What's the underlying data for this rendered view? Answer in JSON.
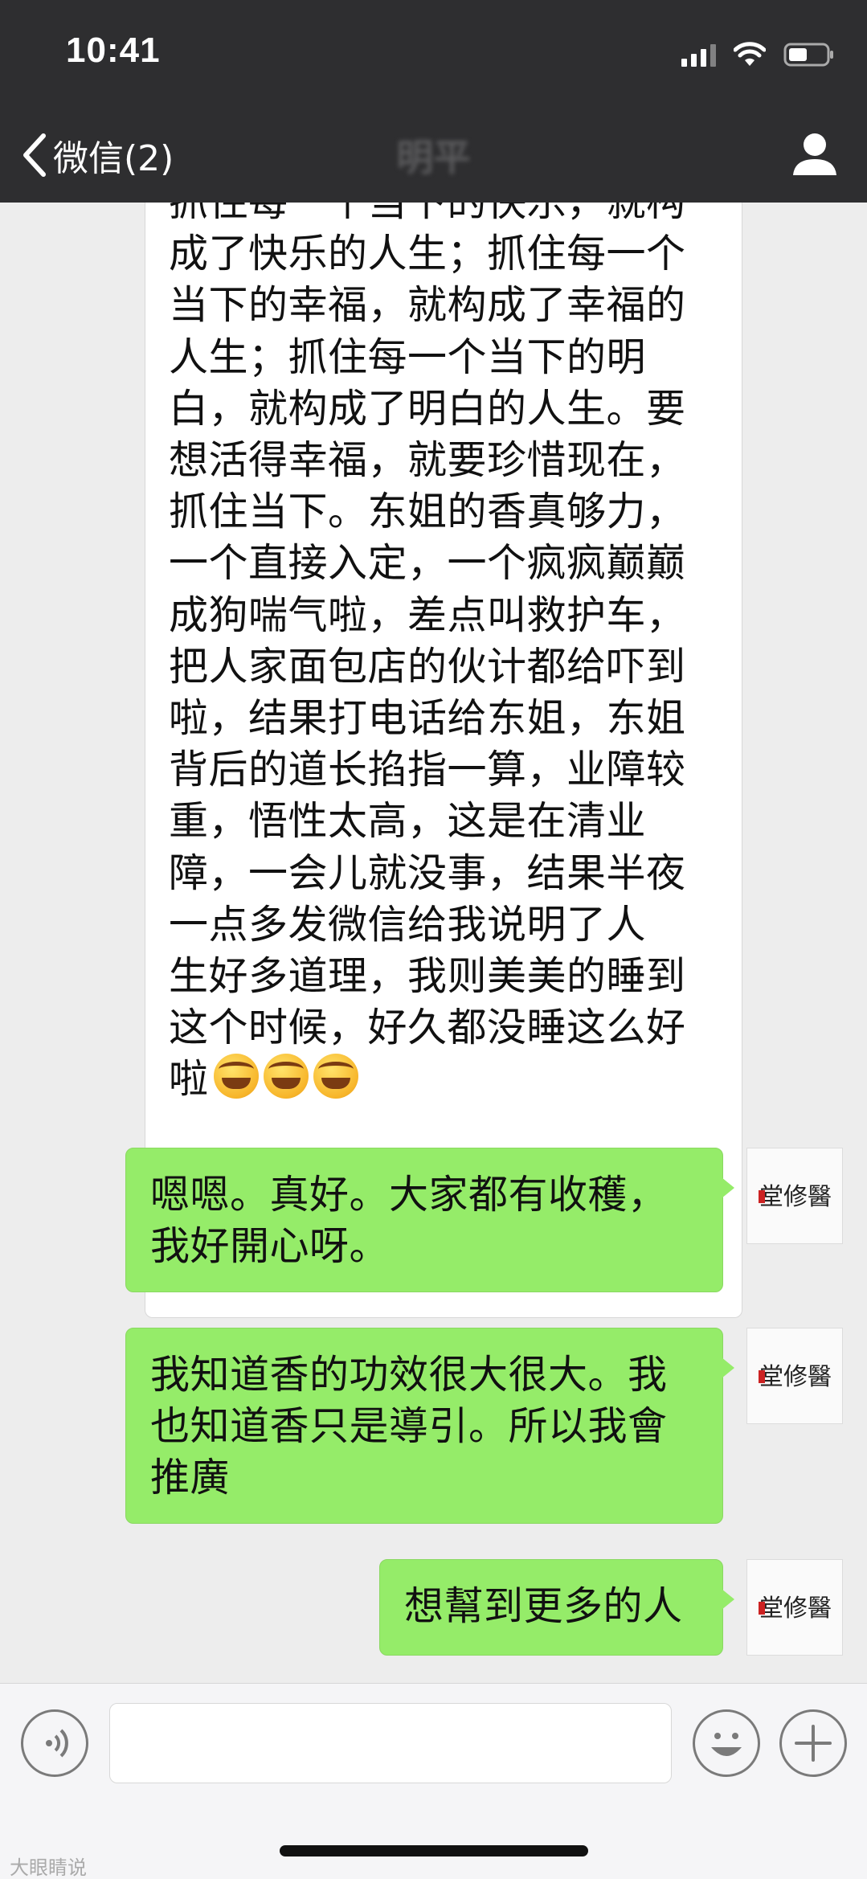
{
  "status_bar": {
    "time": "10:41"
  },
  "nav": {
    "back_label": "微信(2)",
    "title": "明平"
  },
  "messages": [
    {
      "direction": "incoming",
      "text": "抓住每一个当下的快乐，就构\n成了快乐的人生；抓住每一个\n当下的幸福，就构成了幸福的\n人生；抓住每一个当下的明\n白，就构成了明白的人生。要\n想活得幸福，就要珍惜现在，\n抓住当下。东姐的香真够力，\n一个直接入定，一个疯疯巅巅\n成狗喘气啦，差点叫救护车，\n把人家面包店的伙计都给吓到\n啦，结果打电话给东姐，东姐\n背后的道长掐指一算，业障较\n重，悟性太高，这是在清业\n障，一会儿就没事，结果半夜\n一点多发微信给我说明了人\n生好多道理，我则美美的睡到\n这个时候，好久都没睡这么好\n啦",
      "emoji": "crying-laughing-emoji"
    },
    {
      "direction": "outgoing",
      "text": "嗯嗯。真好。大家都有收穫，\n我好開心呀。"
    },
    {
      "direction": "outgoing",
      "text": "我知道香的功效很大很大。我\n也知道香只是導引。所以我會\n推廣"
    },
    {
      "direction": "outgoing",
      "text": "想幫到更多的人"
    }
  ],
  "avatar": {
    "calligraphy": "堂修醫",
    "seal": "玄元"
  },
  "input_bar": {
    "voice_icon": "voice-icon",
    "emoji_icon": "emoji-icon",
    "add_icon": "plus-icon",
    "placeholder": ""
  },
  "watermark": "大眼睛说",
  "colors": {
    "header_bg": "#2e2e30",
    "chat_bg": "#ededed",
    "outgoing_bubble": "#95ec69",
    "incoming_bubble": "#ffffff"
  }
}
